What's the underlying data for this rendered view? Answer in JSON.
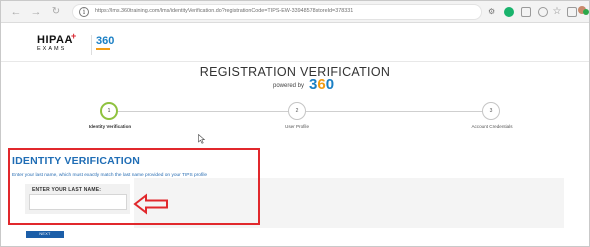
{
  "browser": {
    "url": "https://lms.360training.com/lms/identityVerification.do?registrationCode=TIPS-EW-33948578storeId=378331",
    "icons": [
      "back-icon",
      "forward-icon",
      "refresh-icon",
      "info-icon",
      "key-icon",
      "green-extension-icon",
      "extension-icon",
      "reader-icon",
      "favorite-star-icon",
      "collections-icon",
      "profile-avatar-icon",
      "status-dot-icon"
    ]
  },
  "header": {
    "hipaa_logo_word": "HIPAA",
    "hipaa_logo_plus": "+",
    "hipaa_logo_sub": "EXAMS",
    "logo_360_text": "360"
  },
  "page": {
    "title": "REGISTRATION VERIFICATION",
    "powered_by": "powered by",
    "powered_logo_left": "3",
    "powered_logo_o": "6",
    "powered_logo_right": "0"
  },
  "steps": [
    {
      "number": "1",
      "label": "Identity Verification",
      "active": true
    },
    {
      "number": "2",
      "label": "User Profile",
      "active": false
    },
    {
      "number": "3",
      "label": "Account Credentials",
      "active": false
    }
  ],
  "identity": {
    "heading": "IDENTITY VERIFICATION",
    "instructions": "Enter your last name, which must exactly match the last name provided on your TIPS profile",
    "field_label": "ENTER YOUR LAST NAME:",
    "field_value": "",
    "field_placeholder": ""
  },
  "actions": {
    "next_label": "NEXT"
  },
  "colors": {
    "heading_blue": "#1f6db5",
    "annotation_red": "#e1282c",
    "active_step_green": "#8fc23f",
    "button_blue": "#1b5ea8",
    "brand_orange": "#f39c12"
  }
}
